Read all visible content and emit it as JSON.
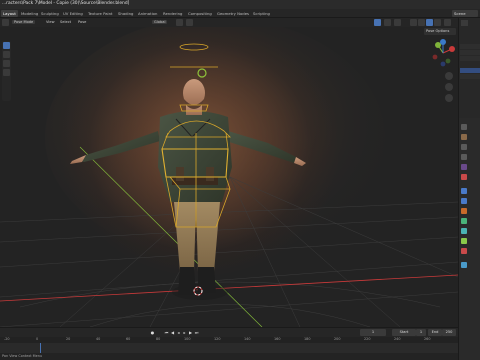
{
  "window_title": "...racters\\Pack 7\\Model - Copie (30)\\Source\\Blender.blend]",
  "workspace_tabs": [
    "Layout",
    "Modeling",
    "Sculpting",
    "UV Editing",
    "Texture Paint",
    "Shading",
    "Animation",
    "Rendering",
    "Compositing",
    "Geometry Nodes",
    "Scripting"
  ],
  "active_tab": "Layout",
  "scene_label": "Scene",
  "viewport_header": {
    "mode": "Pose Mode",
    "view_menu": "View",
    "select_menu": "Select",
    "pose_menu": "Pose",
    "transform_orientation": "Global",
    "pose_options": "Pose Options"
  },
  "gizmo": {
    "x": "X",
    "y": "Y",
    "z": "Z"
  },
  "timeline": {
    "current_frame": "1",
    "start_label": "Start",
    "start_value": "1",
    "end_label": "End",
    "end_value": "250",
    "ticks": [
      "-20",
      "0",
      "20",
      "40",
      "60",
      "80",
      "100",
      "120",
      "140",
      "160",
      "180",
      "200",
      "220",
      "240",
      "260"
    ]
  },
  "status_bar": {
    "hint": "Pan View    Context Menu"
  },
  "colors": {
    "accent": "#4772b3",
    "armature_bones": "#d9a72a",
    "grid": "#3a3a3a",
    "x_axis": "#c93a3a",
    "y_axis": "#7fb33a"
  },
  "icons": [
    "cursor-icon",
    "move-icon",
    "rotate-icon",
    "scale-icon",
    "camera-icon",
    "hand-icon",
    "zoom-icon",
    "eye-icon",
    "filter-icon",
    "wrench-icon",
    "bone-icon",
    "material-icon"
  ]
}
